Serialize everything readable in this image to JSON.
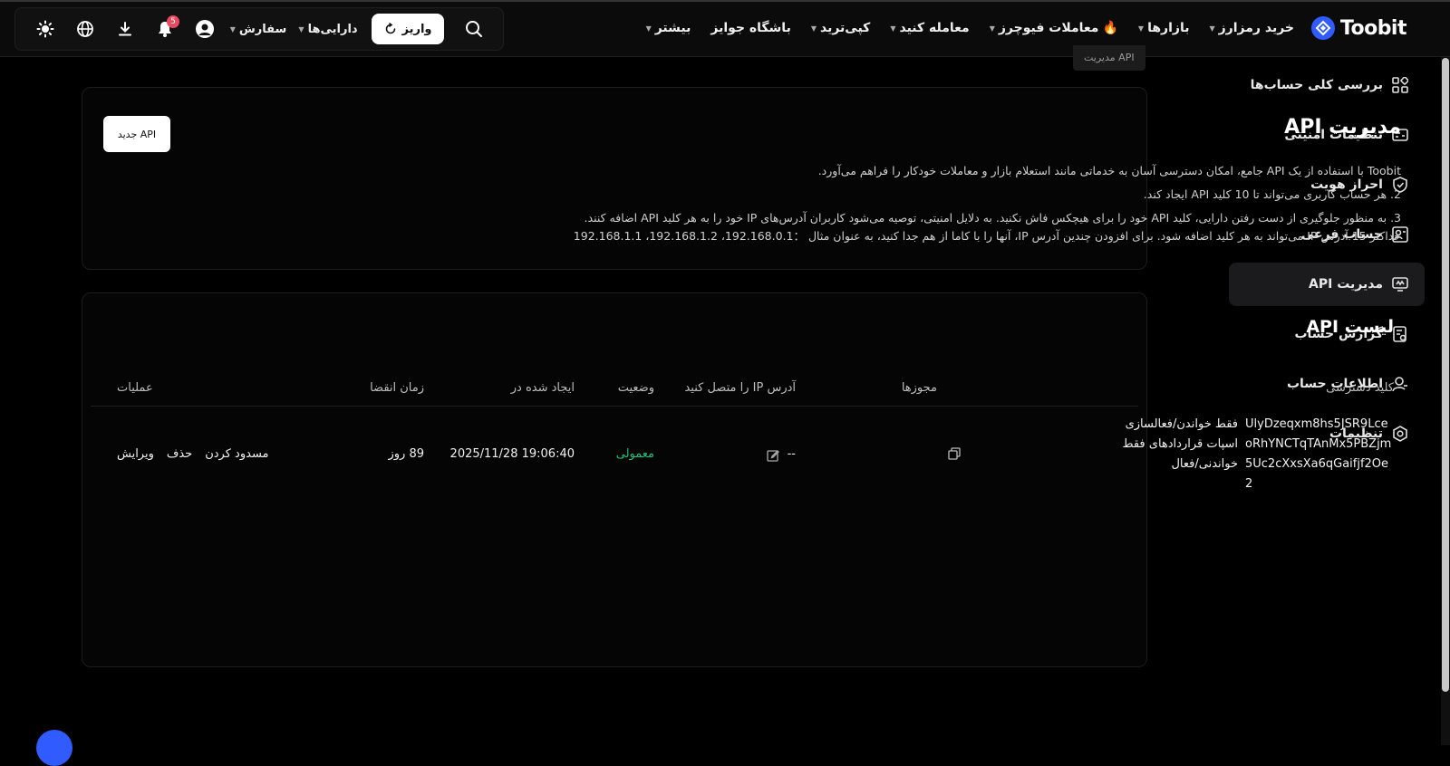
{
  "brand": {
    "name": "Toobit",
    "accent": "#2f5bff"
  },
  "nav": {
    "items": [
      {
        "label": "خرید رمزارز",
        "caret": true
      },
      {
        "label": "بازارها",
        "caret": true
      },
      {
        "label": "معاملات فیوچرز",
        "caret": true,
        "fire": "🔥"
      },
      {
        "label": "معامله کنید",
        "caret": true
      },
      {
        "label": "کپی‌ترید",
        "caret": true
      },
      {
        "label": "باشگاه جوایز",
        "caret": false
      },
      {
        "label": "بیشتر",
        "caret": true
      }
    ]
  },
  "toolbar": {
    "deposit_label": "واریز",
    "assets_label": "دارایی‌ها",
    "orders_label": "سفارش",
    "notif_count": "5"
  },
  "breadcrumb": "مدیریت API",
  "sidebar": {
    "items": [
      {
        "label": "بررسی کلی حساب‌ها",
        "icon": "grid-icon"
      },
      {
        "label": "تنظیمات امنیتی",
        "icon": "id-card-icon"
      },
      {
        "label": "احراز هویت",
        "icon": "shield-check-icon"
      },
      {
        "label": "حساب فرعی",
        "icon": "sub-account-icon"
      },
      {
        "label": "مدیریت API",
        "icon": "api-icon",
        "active": true
      },
      {
        "label": "گزارش حساب",
        "icon": "report-icon"
      },
      {
        "label": "اطلاعات حساب",
        "icon": "user-icon"
      },
      {
        "label": "تنظیمات",
        "icon": "settings-icon"
      }
    ]
  },
  "intro": {
    "title": "مدیریت API",
    "new_api_label": "API جدید",
    "line1": "Toobit با استفاده از یک API جامع، امکان دسترسی آسان به خدماتی مانند استعلام بازار و معاملات خودکار را فراهم می‌آورد.",
    "line2": "2. هر حساب کاربری می‌تواند تا 10 کلید API ایجاد کند.",
    "line3": "3. به منظور جلوگیری از دست رفتن دارایی، کلید API خود را برای هیچکس فاش نکنید. به دلایل امنیتی، توصیه می‌شود کاربران آدرس‌های IP خود را به هر کلید API اضافه کنند.",
    "line4": "حداکثر 15 آدرس IP می‌تواند به هر کلید اضافه شود. برای افزودن چندین آدرس IP، آنها را با کاما از هم جدا کنید، به عنوان مثال ：192.168.0.1، 192.168.1.2، 192.168.1.1"
  },
  "list": {
    "title": "لیست API",
    "headers": {
      "key": "کلید دسترسی",
      "perms": "مجوزها",
      "ip": "آدرس IP را متصل کنید",
      "status": "وضعیت",
      "created": "ایجاد شده در",
      "expiry": "زمان انقضا",
      "actions": "عملیات"
    },
    "rows": [
      {
        "key": "UlyDzeqxm8hs5JSR9LceoRhYNCTqTAnMx5PBZjm5Uc2cXxsXa6qGaifjf2Oe2",
        "perms": "فقط خواندن/فعالسازی اسپات قراردادهای فقط خواندنی/فعال",
        "ip": "--",
        "status": "معمولی",
        "created": "2025/11/28 19:06:40",
        "expiry": "89 روز",
        "action_block": "مسدود کردن",
        "action_delete": "حذف",
        "action_edit": "ویرایش"
      }
    ]
  },
  "colors": {
    "status_normal": "#1fbf7a",
    "badge": "#e84a5f"
  }
}
